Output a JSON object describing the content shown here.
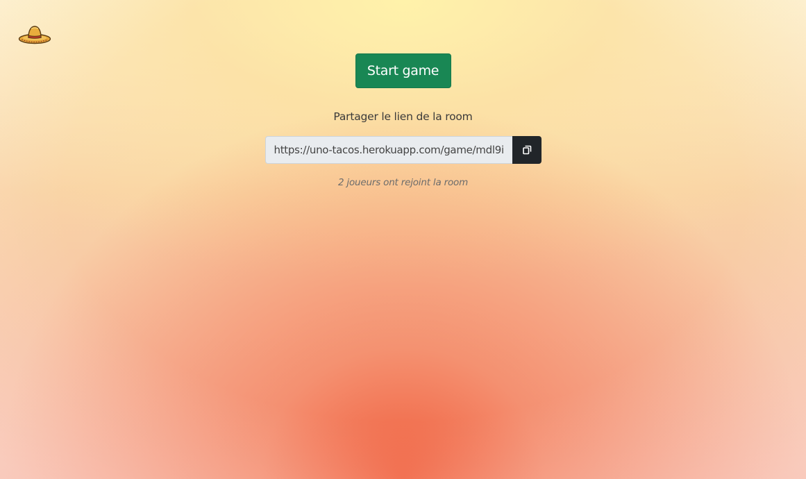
{
  "header": {
    "logo_icon": "sombrero-icon"
  },
  "main": {
    "start_button_label": "Start game",
    "share_label": "Partager le lien de la room",
    "room_link": "https://uno-tacos.herokuapp.com/game/mdl9i",
    "copy_icon": "copy-icon",
    "players_joined_text": "2 joueurs ont rejoint la room"
  },
  "colors": {
    "start_button": "#198754",
    "copy_button": "#212529",
    "input_background": "#e9ecef"
  }
}
